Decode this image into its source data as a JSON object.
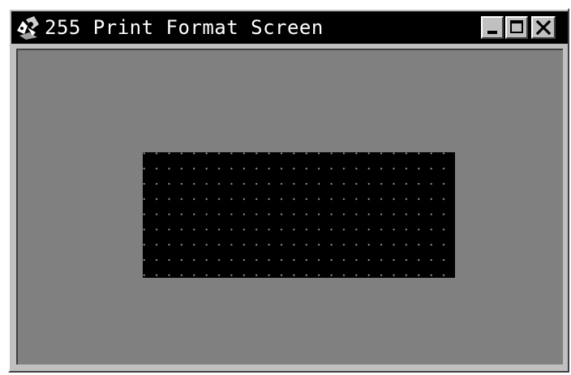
{
  "window": {
    "title": "255 Print Format Screen",
    "icon": "print-format-app-icon",
    "controls": {
      "minimize_icon": "minimize-icon",
      "maximize_icon": "maximize-icon",
      "close_icon": "close-icon"
    }
  },
  "format_area": {
    "description_icon": "dot-grid",
    "colors": {
      "background": "#000000",
      "grid_dots": "#9a9a9a"
    }
  },
  "colors": {
    "titlebar": "#000000",
    "title_text": "#ffffff",
    "client_background": "#808080",
    "window_frame": "#c0c0c0"
  }
}
